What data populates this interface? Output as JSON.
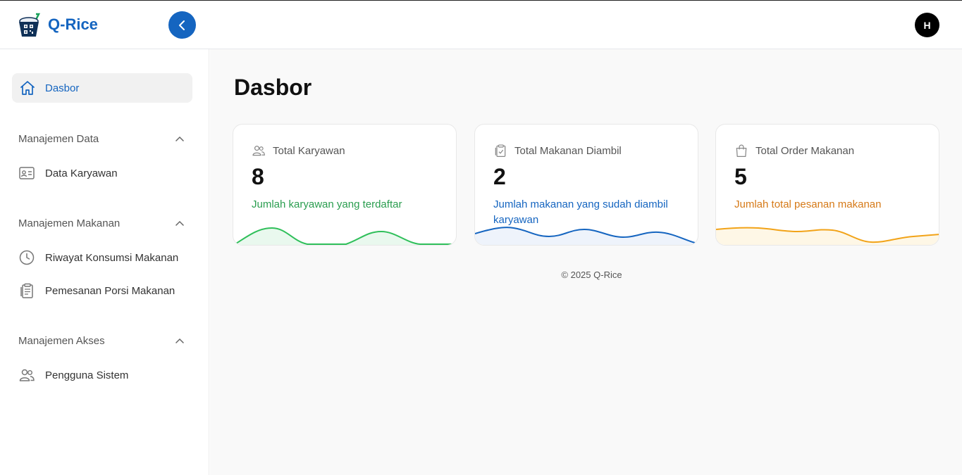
{
  "header": {
    "brand": "Q-Rice",
    "avatar_initial": "H",
    "logo_icon": "rice-bowl-qr-icon",
    "collapse_icon": "chevron-left-icon",
    "accent_color": "#1565c0"
  },
  "sidebar": {
    "active_item": {
      "label": "Dasbor",
      "icon": "home-icon"
    },
    "sections": [
      {
        "title": "Manajemen Data",
        "items": [
          {
            "label": "Data Karyawan",
            "icon": "id-card-icon"
          }
        ]
      },
      {
        "title": "Manajemen Makanan",
        "items": [
          {
            "label": "Riwayat Konsumsi Makanan",
            "icon": "clock-icon"
          },
          {
            "label": "Pemesanan Porsi Makanan",
            "icon": "clipboard-icon"
          }
        ]
      },
      {
        "title": "Manajemen Akses",
        "items": [
          {
            "label": "Pengguna Sistem",
            "icon": "users-icon"
          }
        ]
      }
    ]
  },
  "main": {
    "title": "Dasbor",
    "cards": [
      {
        "label": "Total Karyawan",
        "value": "8",
        "description": "Jumlah karyawan yang terdaftar",
        "color": "#2fbf5a",
        "icon": "users-icon"
      },
      {
        "label": "Total Makanan Diambil",
        "value": "2",
        "description": "Jumlah makanan yang sudah diambil karyawan",
        "color": "#1565c0",
        "icon": "clipboard-check-icon"
      },
      {
        "label": "Total Order Makanan",
        "value": "5",
        "description": "Jumlah total pesanan makanan",
        "color": "#e08a1e",
        "icon": "shopping-bag-icon"
      }
    ],
    "footer": "© 2025 Q-Rice"
  }
}
